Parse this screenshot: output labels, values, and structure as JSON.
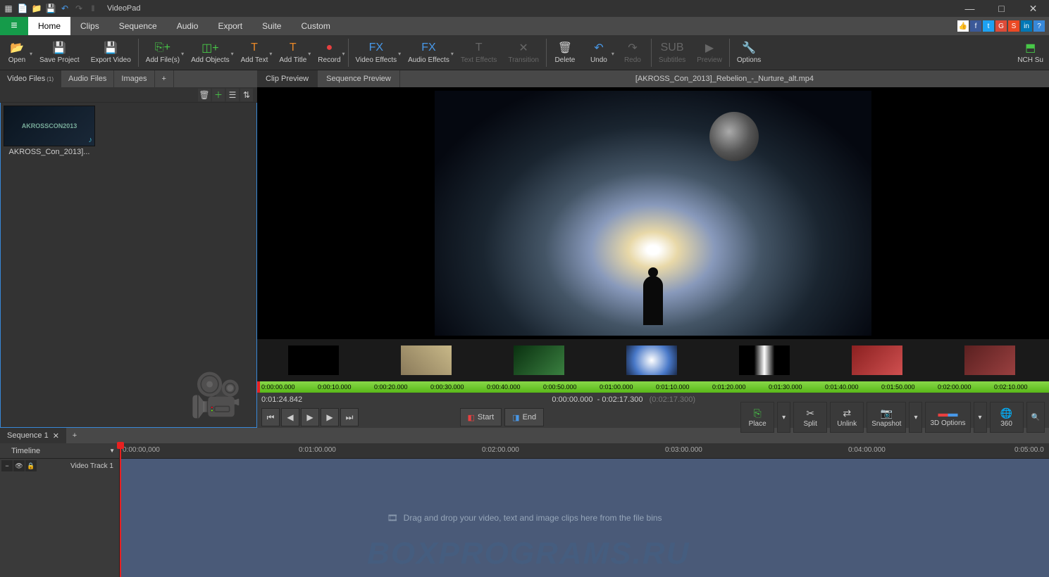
{
  "app": {
    "title": "VideoPad"
  },
  "menu": {
    "items": [
      "Home",
      "Clips",
      "Sequence",
      "Audio",
      "Export",
      "Suite",
      "Custom"
    ],
    "active": "Home"
  },
  "toolbar": {
    "open": "Open",
    "save": "Save Project",
    "export": "Export Video",
    "add_files": "Add File(s)",
    "add_objects": "Add Objects",
    "add_text": "Add Text",
    "add_title": "Add Title",
    "record": "Record",
    "video_fx": "Video Effects",
    "audio_fx": "Audio Effects",
    "text_fx": "Text Effects",
    "transition": "Transition",
    "delete": "Delete",
    "undo": "Undo",
    "redo": "Redo",
    "subtitles": "Subtitles",
    "preview": "Preview",
    "options": "Options",
    "nch": "NCH Su"
  },
  "bins": {
    "tabs": {
      "video": "Video Files",
      "video_count": "(1)",
      "audio": "Audio Files",
      "images": "Images"
    },
    "clip_name": "AKROSS_Con_2013]...",
    "thumb_text": "AKROSSCON2013"
  },
  "preview": {
    "clip_tab": "Clip Preview",
    "seq_tab": "Sequence Preview",
    "filename": "[AKROSS_Con_2013]_Rebelion_-_Nurture_alt.mp4",
    "timecodes": [
      "0:00:00.000",
      "0:00:10.000",
      "0:00:20.000",
      "0:00:30.000",
      "0:00:40.000",
      "0:00:50.000",
      "0:01:00.000",
      "0:01:10.000",
      "0:01:20.000",
      "0:01:30.000",
      "0:01:40.000",
      "0:01:50.000",
      "0:02:00.000",
      "0:02:10.000"
    ]
  },
  "controls": {
    "current_time": "0:01:24.842",
    "range_start": "0:00:00.000",
    "range_sep": "-",
    "range_end": "0:02:17.300",
    "range_dur": "(0:02:17.300)",
    "start": "Start",
    "end": "End",
    "place": "Place",
    "split": "Split",
    "unlink": "Unlink",
    "snapshot": "Snapshot",
    "opt3d": "3D Options",
    "v360": "360"
  },
  "sequence": {
    "tab": "Sequence 1",
    "timeline_label": "Timeline",
    "ruler": [
      "0:00:00,000",
      "0:01:00.000",
      "0:02:00.000",
      "0:03:00.000",
      "0:04:00.000",
      "0:05:00.0"
    ],
    "track": "Video Track 1",
    "hint": "Drag and drop your video, text and image clips here from the file bins",
    "watermark": "BOXPROGRAMS.RU"
  }
}
